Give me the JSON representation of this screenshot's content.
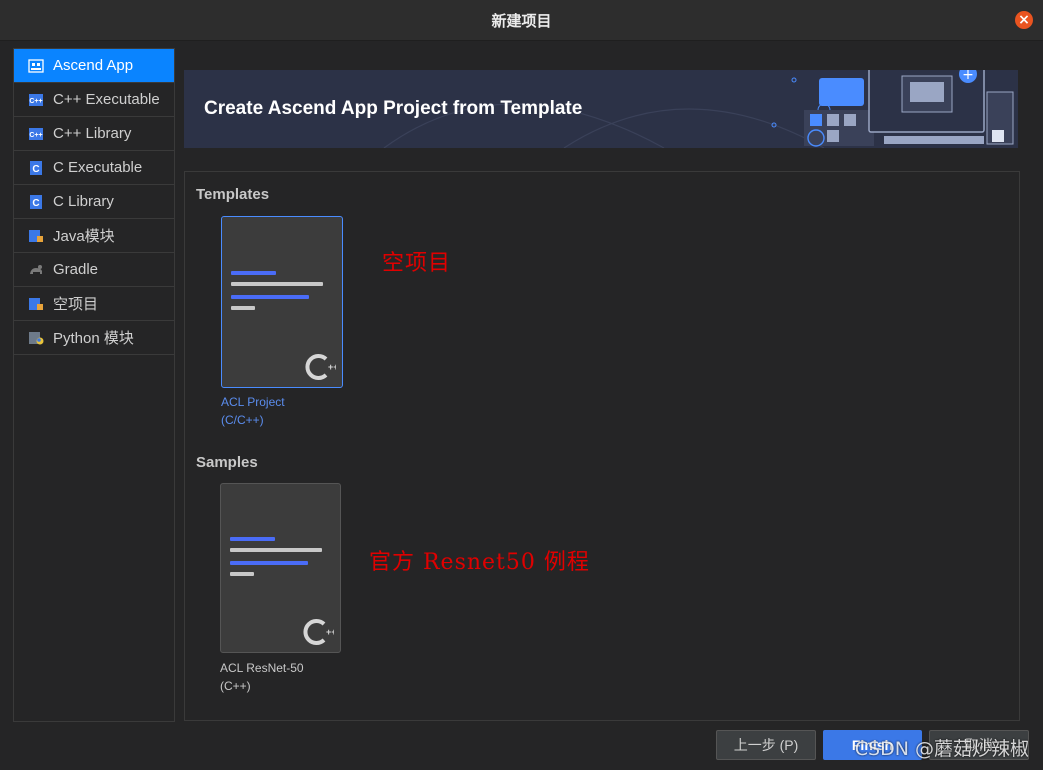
{
  "window": {
    "title": "新建项目",
    "close_icon": "close-icon"
  },
  "sidebar": {
    "items": [
      {
        "label": "Ascend App",
        "icon": "ascend-app-icon",
        "active": true
      },
      {
        "label": "C++ Executable",
        "icon": "cpp-executable-icon"
      },
      {
        "label": "C++ Library",
        "icon": "cpp-library-icon"
      },
      {
        "label": "C Executable",
        "icon": "c-executable-icon"
      },
      {
        "label": "C Library",
        "icon": "c-library-icon"
      },
      {
        "label": "Java模块",
        "icon": "java-module-icon"
      },
      {
        "label": "Gradle",
        "icon": "gradle-icon"
      },
      {
        "label": "空项目",
        "icon": "empty-project-icon"
      },
      {
        "label": "Python 模块",
        "icon": "python-module-icon"
      }
    ]
  },
  "banner": {
    "title": "Create Ascend App Project from Template"
  },
  "templates": {
    "label": "Templates",
    "cards": [
      {
        "name_line1": "ACL Project",
        "name_line2": "(C/C++)",
        "selected": true
      }
    ]
  },
  "samples": {
    "label": "Samples",
    "cards": [
      {
        "name_line1": "ACL ResNet-50",
        "name_line2": "(C++)",
        "selected": false
      }
    ]
  },
  "annotations": {
    "empty_project": "空项目",
    "resnet": "官方 Resnet50 例程"
  },
  "footer": {
    "prev_label": "上一步 (P)",
    "finish_label": "Finish",
    "cancel_label": "取消"
  },
  "watermark": "CSDN @蘑菇炒辣椒",
  "colors": {
    "accent": "#0a84ff",
    "selected_border": "#4a8cff",
    "close": "#e95420",
    "annotation": "#e00000"
  }
}
